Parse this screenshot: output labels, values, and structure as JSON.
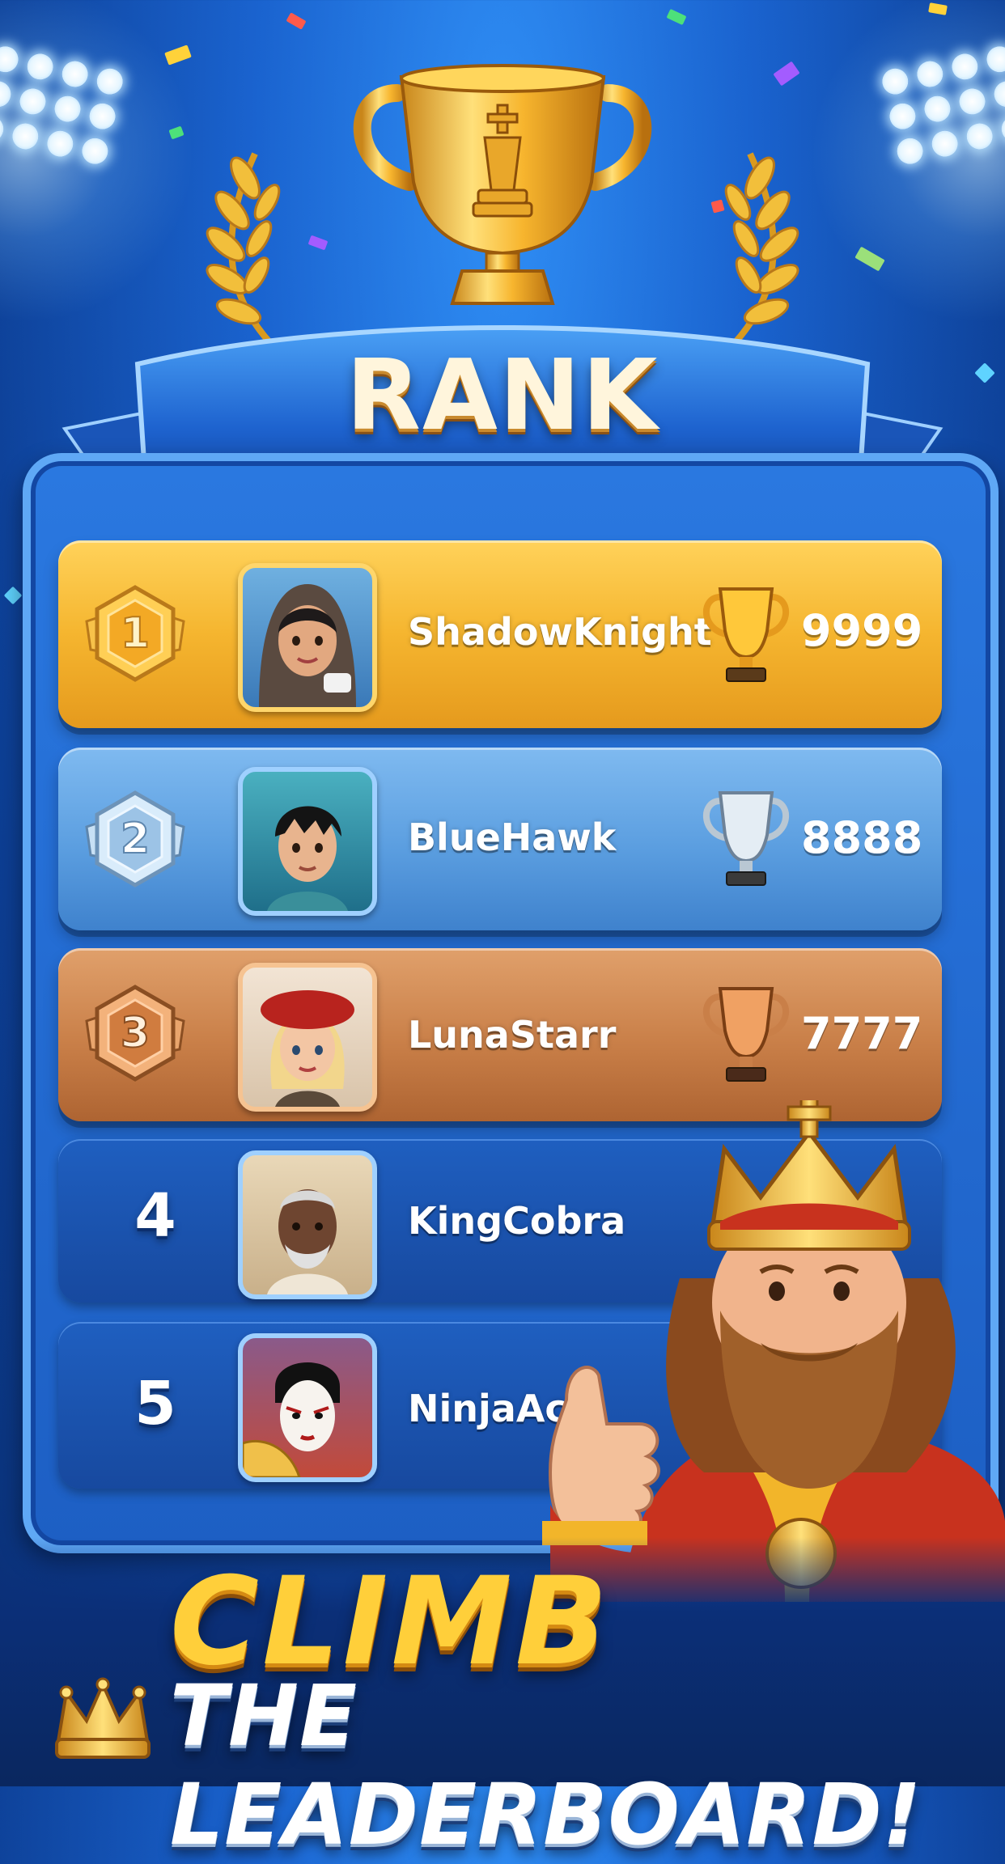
{
  "title": "RANK",
  "colors": {
    "background": "#1a63cf",
    "gold_row": "#f5b52f",
    "silver_row": "#5b9ee0",
    "bronze_row": "#c97f48",
    "plain_row": "#17499f",
    "title_text": "#fff5dc",
    "climb_text": "#ffcf3a"
  },
  "leaderboard": {
    "rows": [
      {
        "rank": "1",
        "name": "ShadowKnight",
        "score": "9999",
        "tier": "gold",
        "avatar": "woman-with-hijab-holding-teacup-avatar"
      },
      {
        "rank": "2",
        "name": "BlueHawk",
        "score": "8888",
        "tier": "silver",
        "avatar": "young-man-dark-hair-avatar"
      },
      {
        "rank": "3",
        "name": "LunaStarr",
        "score": "7777",
        "tier": "bronze",
        "avatar": "blonde-woman-red-beret-avatar"
      },
      {
        "rank": "4",
        "name": "KingCobra",
        "tier": "none",
        "avatar": "elderly-man-white-beard-avatar"
      },
      {
        "rank": "5",
        "name": "NinjaAce",
        "tier": "none",
        "avatar": "kabuki-face-with-fan-avatar"
      }
    ]
  },
  "tagline": {
    "line1": "CLIMB",
    "line2": "THE LEADERBOARD!"
  },
  "icons": {
    "header": "chess-king-trophy-icon",
    "laurels": "laurel-wreath-icon",
    "mascot": "king-mascot-thumbs-up",
    "tagline_icon": "crown-icon"
  }
}
